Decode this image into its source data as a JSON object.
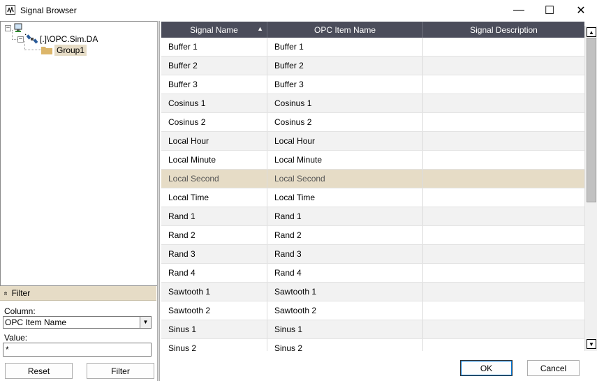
{
  "window": {
    "title": "Signal Browser",
    "min_glyph": "—",
    "max_glyph": "☐",
    "close_glyph": "✕"
  },
  "tree": {
    "root_expander": "−",
    "server_expander": "−",
    "root_label": ".",
    "server_label": "[.]\\OPC.Sim.DA",
    "group_label": "Group1"
  },
  "filter": {
    "header_label": "Filter",
    "collapse_glyph": "«",
    "column_label": "Column:",
    "column_value": "OPC Item Name",
    "value_label": "Value:",
    "value_text": "*",
    "reset_label": "Reset",
    "filter_label": "Filter"
  },
  "grid": {
    "columns": [
      "Signal Name",
      "OPC Item Name",
      "Signal Description"
    ],
    "sort_glyph": "▲",
    "selected_index": 7,
    "rows": [
      [
        "Buffer 1",
        "Buffer 1",
        ""
      ],
      [
        "Buffer 2",
        "Buffer 2",
        ""
      ],
      [
        "Buffer 3",
        "Buffer 3",
        ""
      ],
      [
        "Cosinus 1",
        "Cosinus 1",
        ""
      ],
      [
        "Cosinus 2",
        "Cosinus 2",
        ""
      ],
      [
        "Local Hour",
        "Local Hour",
        ""
      ],
      [
        "Local Minute",
        "Local Minute",
        ""
      ],
      [
        "Local Second",
        "Local Second",
        ""
      ],
      [
        "Local Time",
        "Local Time",
        ""
      ],
      [
        "Rand 1",
        "Rand 1",
        ""
      ],
      [
        "Rand 2",
        "Rand 2",
        ""
      ],
      [
        "Rand 3",
        "Rand 3",
        ""
      ],
      [
        "Rand 4",
        "Rand 4",
        ""
      ],
      [
        "Sawtooth 1",
        "Sawtooth 1",
        ""
      ],
      [
        "Sawtooth 2",
        "Sawtooth 2",
        ""
      ],
      [
        "Sinus 1",
        "Sinus 1",
        ""
      ],
      [
        "Sinus 2",
        "Sinus 2",
        ""
      ]
    ]
  },
  "dialog": {
    "ok_label": "OK",
    "cancel_label": "Cancel"
  },
  "scrollbar": {
    "up_glyph": "▲",
    "down_glyph": "▼"
  },
  "colors": {
    "header_bg": "#4b4d5b",
    "selection_bg": "#e6dcc6",
    "alt_row_bg": "#f2f2f2"
  }
}
